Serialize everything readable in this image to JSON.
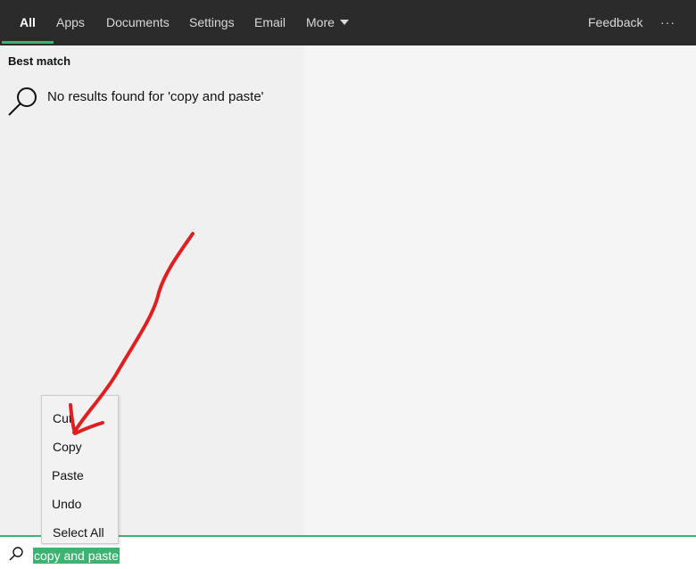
{
  "tabs": [
    {
      "label": "All",
      "active": true
    },
    {
      "label": "Apps"
    },
    {
      "label": "Documents"
    },
    {
      "label": "Settings"
    },
    {
      "label": "Email"
    },
    {
      "label": "More"
    }
  ],
  "feedback_label": "Feedback",
  "more_options_label": "···",
  "best_match_heading": "Best match",
  "no_results_text": "No results found for 'copy and paste'",
  "search": {
    "query": "copy and paste"
  },
  "context_menu": [
    "Cut",
    "Copy",
    "Paste",
    "Undo",
    "Select All"
  ],
  "colors": {
    "accent": "#3cb371",
    "topbar": "#2b2b2b",
    "annotation": "#e02020"
  }
}
